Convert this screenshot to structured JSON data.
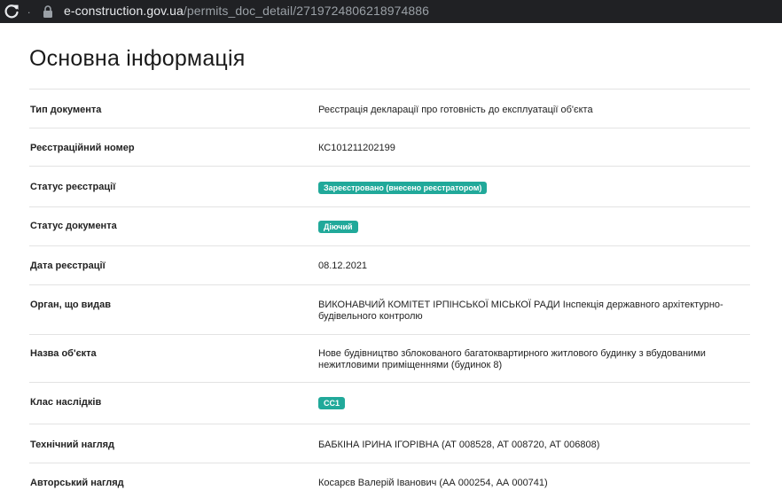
{
  "browser": {
    "url_host": "e-construction.gov.ua",
    "url_path": "/permits_doc_detail/2719724806218974886",
    "dot": "."
  },
  "page": {
    "title": "Основна інформація"
  },
  "rows": [
    {
      "label": "Тип документа",
      "value": "Реєстрація декларації про готовність до експлуатації об'єкта",
      "type": "text"
    },
    {
      "label": "Реєстраційний номер",
      "value": "КС101211202199",
      "type": "text"
    },
    {
      "label": "Статус реєстрації",
      "value": "Зареєстровано (внесено реєстратором)",
      "type": "badge"
    },
    {
      "label": "Статус документа",
      "value": "Діючий",
      "type": "badge"
    },
    {
      "label": "Дата реєстрації",
      "value": "08.12.2021",
      "type": "text"
    },
    {
      "label": "Орган, що видав",
      "value": "ВИКОНАВЧИЙ КОМІТЕТ ІРПІНСЬКОЇ МІСЬКОЇ РАДИ Інспекція державного архітектурно-будівельного контролю",
      "type": "text"
    },
    {
      "label": "Назва об'єкта",
      "value": "Нове будівництво зблокованого багатоквартирного житлового будинку з вбудованими нежитловими приміщеннями (будинок 8)",
      "type": "text"
    },
    {
      "label": "Клас наслідків",
      "value": "СС1",
      "type": "badge"
    },
    {
      "label": "Технічний нагляд",
      "value": "БАБКІНА ІРИНА ІГОРІВНА (АТ 008528, АТ 008720, АТ 006808)",
      "type": "text"
    },
    {
      "label": "Авторський нагляд",
      "value": "Косарєв Валерій Іванович (АА 000254, АА 000741)",
      "type": "text"
    }
  ],
  "colors": {
    "badge": "#21a99a",
    "browser_bar": "#202124"
  },
  "icons": {
    "reload": "reload-icon",
    "lock": "lock-icon"
  }
}
